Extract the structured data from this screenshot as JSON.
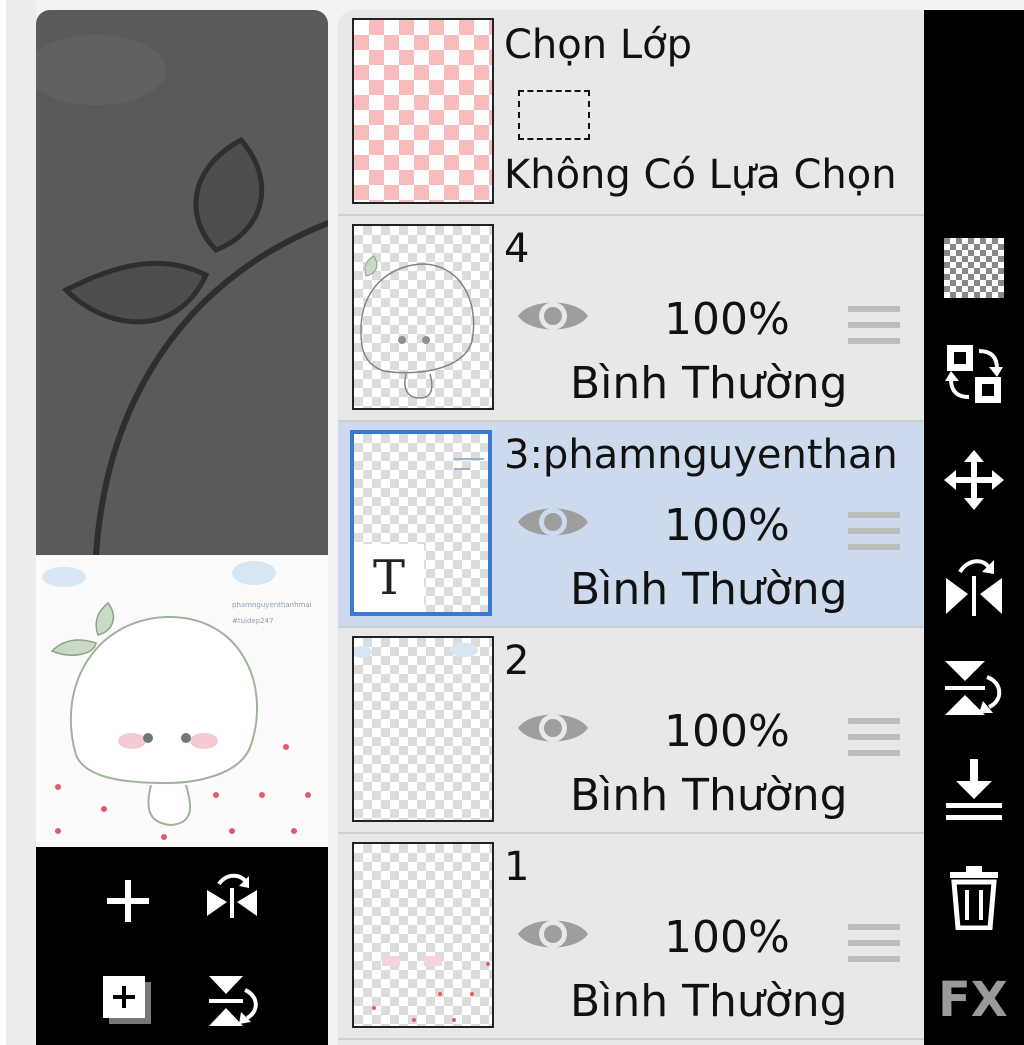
{
  "selection_layer": {
    "title": "Chọn Lớp",
    "status": "Không Có Lựa Chọn"
  },
  "layers": [
    {
      "name": "4",
      "opacity": "100%",
      "blend": "Bình Thường",
      "selected": false
    },
    {
      "name": "3:phamnguyenthan",
      "opacity": "100%",
      "blend": "Bình Thường",
      "selected": true
    },
    {
      "name": "2",
      "opacity": "100%",
      "blend": "Bình Thường",
      "selected": false
    },
    {
      "name": "1",
      "opacity": "100%",
      "blend": "Bình Thường",
      "selected": false
    }
  ],
  "preview": {
    "watermark_line1": "phamnguyenthanhmai",
    "watermark_line2": "#tuidep247"
  },
  "text_layer_badge": "T",
  "right_toolbar": {
    "fx_label": "FX"
  },
  "colors": {
    "selected_row": "#cdd9ec",
    "selected_border": "#3a78d6",
    "panel_bg": "#e8e8e8"
  },
  "icons": [
    "transparent-fill-icon",
    "swap-layer-icon",
    "move-icon",
    "flip-horizontal-icon",
    "flip-vertical-icon",
    "merge-down-icon",
    "trash-icon",
    "add-layer-icon",
    "add-layer-copy-icon"
  ]
}
